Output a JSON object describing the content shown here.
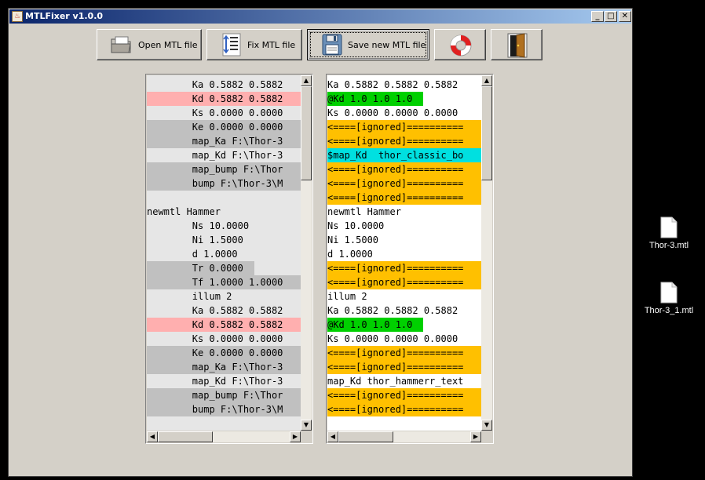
{
  "window": {
    "title": "MTLFixer v1.0.0"
  },
  "titlebar_buttons": [
    "_",
    "□",
    "✕"
  ],
  "toolbar": {
    "open_label": "Open MTL file",
    "fix_label": "Fix MTL file",
    "save_label": "Save new MTL file",
    "help_icon": "lifebuoy-icon",
    "exit_icon": "exit-door-icon"
  },
  "colors": {
    "removed": "#ffafaf",
    "grey": "#c0c0c0",
    "light": "#e4e4e4",
    "added": "#00d000",
    "modified": "#00e0e0",
    "ignored": "#ffc000"
  },
  "left_lines": [
    {
      "text": "        Ka 0.5882 0.5882",
      "hl": "light"
    },
    {
      "text": "        Kd 0.5882 0.5882",
      "hl": "removed"
    },
    {
      "text": "        Ks 0.0000 0.0000",
      "hl": "light"
    },
    {
      "text": "        Ke 0.0000 0.0000",
      "hl": "grey"
    },
    {
      "text": "        map_Ka F:\\Thor-3",
      "hl": "grey"
    },
    {
      "text": "        map_Kd F:\\Thor-3",
      "hl": "light"
    },
    {
      "text": "        map_bump F:\\Thor",
      "hl": "grey"
    },
    {
      "text": "        bump F:\\Thor-3\\M",
      "hl": "grey"
    },
    {
      "text": "",
      "hl": "light"
    },
    {
      "text": "newmtl Hammer",
      "hl": "light"
    },
    {
      "text": "        Ns 10.0000",
      "hl": "light"
    },
    {
      "text": "        Ni 1.5000",
      "hl": "light"
    },
    {
      "text": "        d 1.0000",
      "hl": "light"
    },
    {
      "text": "        Tr 0.0000",
      "hl": "grey-short"
    },
    {
      "text": "        Tf 1.0000 1.0000",
      "hl": "grey"
    },
    {
      "text": "        illum 2",
      "hl": "light"
    },
    {
      "text": "        Ka 0.5882 0.5882",
      "hl": "light"
    },
    {
      "text": "        Kd 0.5882 0.5882",
      "hl": "removed"
    },
    {
      "text": "        Ks 0.0000 0.0000",
      "hl": "light"
    },
    {
      "text": "        Ke 0.0000 0.0000",
      "hl": "grey"
    },
    {
      "text": "        map_Ka F:\\Thor-3",
      "hl": "grey"
    },
    {
      "text": "        map_Kd F:\\Thor-3",
      "hl": "light"
    },
    {
      "text": "        map_bump F:\\Thor",
      "hl": "grey"
    },
    {
      "text": "        bump F:\\Thor-3\\M",
      "hl": "grey"
    }
  ],
  "right_lines": [
    {
      "text": "Ka 0.5882 0.5882 0.5882",
      "hl": "none"
    },
    {
      "text": "@Kd 1.0 1.0 1.0",
      "hl": "added"
    },
    {
      "text": "Ks 0.0000 0.0000 0.0000",
      "hl": "none"
    },
    {
      "text": "<====[ignored]==========",
      "hl": "ignored"
    },
    {
      "text": "<====[ignored]==========",
      "hl": "ignored"
    },
    {
      "text": "$map_Kd  thor_classic_bo",
      "hl": "modified"
    },
    {
      "text": "<====[ignored]==========",
      "hl": "ignored"
    },
    {
      "text": "<====[ignored]==========",
      "hl": "ignored"
    },
    {
      "text": "<====[ignored]==========",
      "hl": "ignored"
    },
    {
      "text": "newmtl Hammer",
      "hl": "none"
    },
    {
      "text": "Ns 10.0000",
      "hl": "none"
    },
    {
      "text": "Ni 1.5000",
      "hl": "none"
    },
    {
      "text": "d 1.0000",
      "hl": "none"
    },
    {
      "text": "<====[ignored]==========",
      "hl": "ignored"
    },
    {
      "text": "<====[ignored]==========",
      "hl": "ignored"
    },
    {
      "text": "illum 2",
      "hl": "none"
    },
    {
      "text": "Ka 0.5882 0.5882 0.5882",
      "hl": "none"
    },
    {
      "text": "@Kd 1.0 1.0 1.0",
      "hl": "added"
    },
    {
      "text": "Ks 0.0000 0.0000 0.0000",
      "hl": "none"
    },
    {
      "text": "<====[ignored]==========",
      "hl": "ignored"
    },
    {
      "text": "<====[ignored]==========",
      "hl": "ignored"
    },
    {
      "text": "map_Kd thor_hammerr_text",
      "hl": "none"
    },
    {
      "text": "<====[ignored]==========",
      "hl": "ignored"
    },
    {
      "text": "<====[ignored]==========",
      "hl": "ignored"
    }
  ],
  "desktop_files": [
    {
      "name": "Thor-3.mtl"
    },
    {
      "name": "Thor-3_1.mtl"
    }
  ]
}
